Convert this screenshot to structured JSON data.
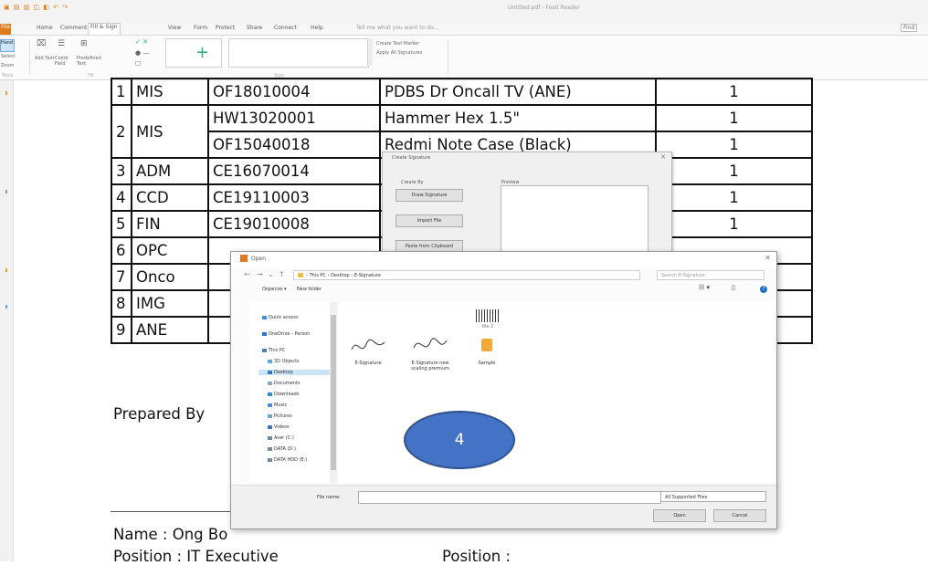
{
  "app": {
    "title": "Untitled.pdf - Foxit Reader",
    "tabs": [
      "File",
      "Home",
      "Comment",
      "Fill & Sign",
      "View",
      "Form",
      "Protect",
      "Share",
      "Connect",
      "Help"
    ],
    "active_tab": "Fill & Sign",
    "tell_me": "Tell me what you want to do...",
    "help_label": "Find",
    "ribbon": {
      "select": "Hand",
      "select2": "Select",
      "zoom": "Zoom",
      "add_text": "Add Text",
      "comb_field": "Comb Field",
      "predefined_text": "Predefined Text",
      "tools_label": "Tools",
      "fill_label": "Fill",
      "sign_label": "Sign",
      "create_text_marker": "Create Text Marker",
      "apply_all_signatures": "Apply All Signatures"
    }
  },
  "document": {
    "rows": [
      {
        "no": "1",
        "dept": "MIS",
        "code": "OF18010004",
        "desc": "PDBS Dr Oncall TV (ANE)",
        "qty": "1"
      },
      {
        "no": "2",
        "dept": "MIS",
        "code": "HW13020001",
        "desc": "Hammer Hex 1.5\"",
        "qty": "1"
      },
      {
        "no": "",
        "dept": "",
        "code": "OF15040018",
        "desc": "Redmi Note Case (Black)",
        "qty": "1"
      },
      {
        "no": "3",
        "dept": "ADM",
        "code": "CE16070014",
        "desc": "",
        "qty": "1"
      },
      {
        "no": "4",
        "dept": "CCD",
        "code": "CE19110003",
        "desc": "",
        "qty": "1"
      },
      {
        "no": "5",
        "dept": "FIN",
        "code": "CE19010008",
        "desc": "",
        "qty": "1"
      },
      {
        "no": "6",
        "dept": "OPC",
        "code": "",
        "desc": "",
        "qty": ""
      },
      {
        "no": "7",
        "dept": "Onco",
        "code": "",
        "desc": "",
        "qty": ""
      },
      {
        "no": "8",
        "dept": "IMG",
        "code": "",
        "desc": "",
        "qty": ""
      },
      {
        "no": "9",
        "dept": "ANE",
        "code": "",
        "desc": "",
        "qty": ""
      }
    ],
    "prepared_by": "Prepared By",
    "name_line": "Name : Ong Bo",
    "position_line": "Position : IT Executive",
    "position_line2": "Position :"
  },
  "create_signature_dialog": {
    "title": "Create Signature",
    "create_by": "Create By",
    "preview": "Preview",
    "buttons": [
      "Draw Signature",
      "Import File",
      "Paste from Clipboard"
    ]
  },
  "open_dialog": {
    "title": "Open",
    "breadcrumb": "› This PC › Desktop › E-Signature",
    "search_placeholder": "Search E-Signature",
    "organize": "Organize ▾",
    "new_folder": "New folder",
    "nav_items": [
      "Quick access",
      "OneDrive - Person",
      "This PC",
      "3D Objects",
      "Desktop",
      "Documents",
      "Downloads",
      "Music",
      "Pictures",
      "Videos",
      "Acer (C:)",
      "DATA (D:)",
      "DATA HDD (E:)"
    ],
    "selected_nav": "Desktop",
    "files": [
      {
        "name": "E-Signature",
        "kind": "signature"
      },
      {
        "name": "E-Signature new scaling premium",
        "kind": "signature"
      },
      {
        "name": "Sample",
        "kind": "pdf"
      }
    ],
    "top_file_label": "file 2",
    "file_name_label": "File name:",
    "file_name_value": "",
    "file_type": "All Supported Files",
    "open_button": "Open",
    "cancel_button": "Cancel"
  },
  "callout": {
    "label": "4",
    "color": "#4472c4"
  },
  "colors": {
    "accent": "#e07a1f",
    "selection": "#cce4f7",
    "brand_green": "#2bb37a"
  }
}
